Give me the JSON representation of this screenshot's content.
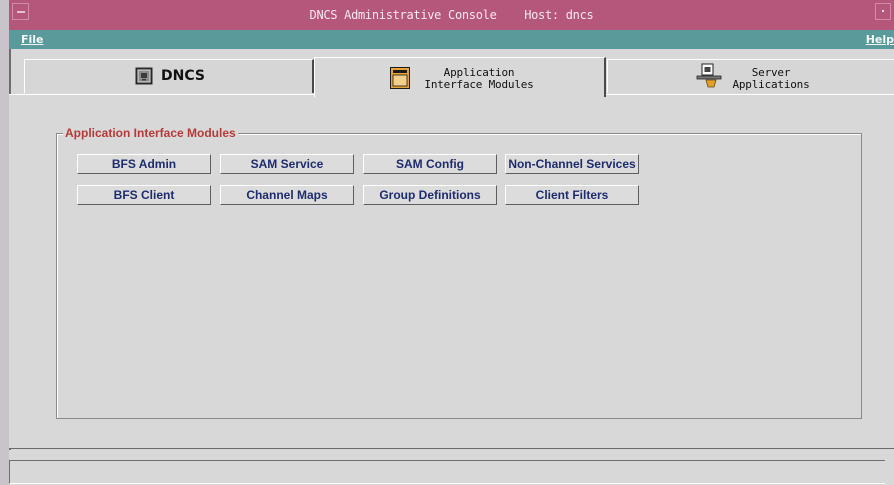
{
  "window": {
    "title": "DNCS Administrative Console    Host: dncs"
  },
  "menubar": {
    "file_label": "File",
    "help_label": "Help"
  },
  "tabs": [
    {
      "label": "DNCS",
      "icon": "monitor-icon",
      "active": false
    },
    {
      "label": "Application\nInterface Modules",
      "icon": "document-icon",
      "active": true
    },
    {
      "label": "Server\nApplications",
      "icon": "server-app-icon",
      "active": false
    }
  ],
  "groupbox": {
    "title": "Application Interface Modules"
  },
  "buttons": [
    [
      "BFS Admin",
      "SAM Service",
      "SAM Config",
      "Non-Channel Services"
    ],
    [
      "BFS Client",
      "Channel Maps",
      "Group Definitions",
      "Client Filters"
    ]
  ],
  "statusbar": {
    "text": ""
  },
  "colors": {
    "titlebar": "#b5567b",
    "menubar": "#5a9a9b",
    "group_title": "#b53a3a",
    "button_text": "#1e2c6e"
  }
}
